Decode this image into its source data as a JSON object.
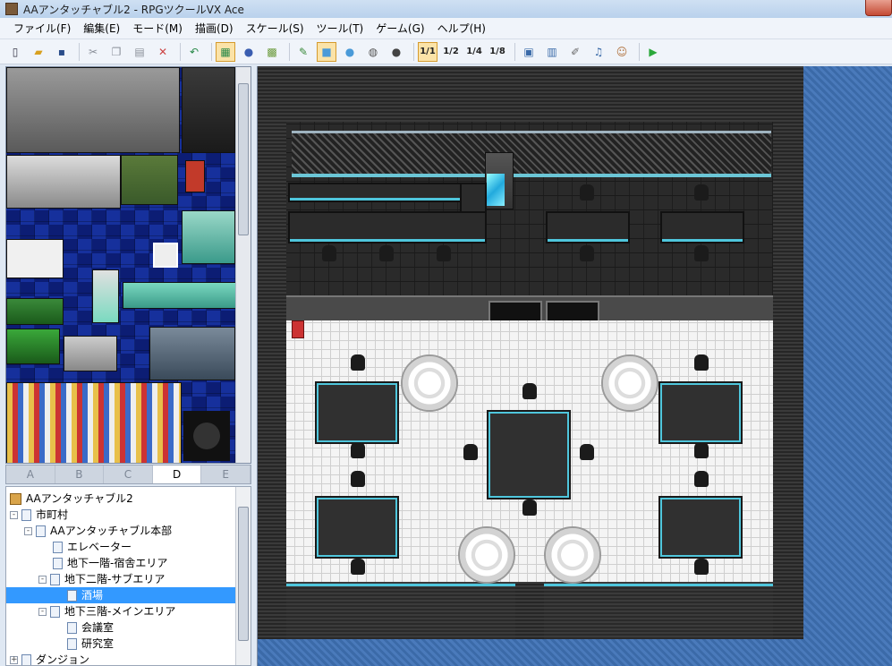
{
  "window": {
    "title": "AAアンタッチャブル2 - RPGツクールVX Ace"
  },
  "menu": {
    "items": [
      "ファイル(F)",
      "編集(E)",
      "モード(M)",
      "描画(D)",
      "スケール(S)",
      "ツール(T)",
      "ゲーム(G)",
      "ヘルプ(H)"
    ]
  },
  "toolbar": {
    "buttons": [
      {
        "icon": "new-file-icon",
        "glyph": "▯"
      },
      {
        "icon": "open-folder-icon",
        "glyph": "▰"
      },
      {
        "icon": "save-icon",
        "glyph": "▪"
      },
      {
        "icon": "cut-icon",
        "glyph": "✂"
      },
      {
        "icon": "copy-icon",
        "glyph": "❐"
      },
      {
        "icon": "paste-icon",
        "glyph": "▤"
      },
      {
        "icon": "delete-icon",
        "glyph": "✕"
      },
      {
        "icon": "undo-icon",
        "glyph": "↶"
      },
      {
        "icon": "map-layer-icon",
        "glyph": "▦"
      },
      {
        "icon": "event-layer-icon",
        "glyph": "●"
      },
      {
        "icon": "region-icon",
        "glyph": "▩"
      },
      {
        "icon": "pencil-icon",
        "glyph": "✎"
      },
      {
        "icon": "rectangle-icon",
        "glyph": "■"
      },
      {
        "icon": "ellipse-icon",
        "glyph": "●"
      },
      {
        "icon": "fill-icon",
        "glyph": "◍"
      },
      {
        "icon": "shadow-pen-icon",
        "glyph": "●"
      },
      {
        "icon": "scale-1-1-icon",
        "glyph": "1/1"
      },
      {
        "icon": "scale-1-2-icon",
        "glyph": "1/2"
      },
      {
        "icon": "scale-1-4-icon",
        "glyph": "1/4"
      },
      {
        "icon": "scale-1-8-icon",
        "glyph": "1/8"
      },
      {
        "icon": "database-icon",
        "glyph": "▣"
      },
      {
        "icon": "resource-manager-icon",
        "glyph": "▥"
      },
      {
        "icon": "script-editor-icon",
        "glyph": "✐"
      },
      {
        "icon": "sound-test-icon",
        "glyph": "♫"
      },
      {
        "icon": "character-generator-icon",
        "glyph": "☺"
      },
      {
        "icon": "playtest-icon",
        "glyph": "▶"
      }
    ]
  },
  "tileset_tabs": [
    "A",
    "B",
    "C",
    "D",
    "E"
  ],
  "tileset_active_tab": "D",
  "tree": {
    "rows": [
      {
        "label": "AAアンタッチャブル2",
        "type": "project"
      },
      {
        "label": "市町村",
        "type": "map",
        "expander": "-"
      },
      {
        "label": "AAアンタッチャブル本部",
        "type": "map",
        "expander": "-"
      },
      {
        "label": "エレベーター",
        "type": "map"
      },
      {
        "label": "地下一階-宿舎エリア",
        "type": "map"
      },
      {
        "label": "地下二階-サブエリア",
        "type": "map",
        "expander": "-"
      },
      {
        "label": "酒場",
        "type": "map",
        "selected": true
      },
      {
        "label": "地下三階-メインエリア",
        "type": "map",
        "expander": "-"
      },
      {
        "label": "会議室",
        "type": "map"
      },
      {
        "label": "研究室",
        "type": "map"
      },
      {
        "label": "ダンジョン",
        "type": "map",
        "expander": "+"
      }
    ]
  }
}
